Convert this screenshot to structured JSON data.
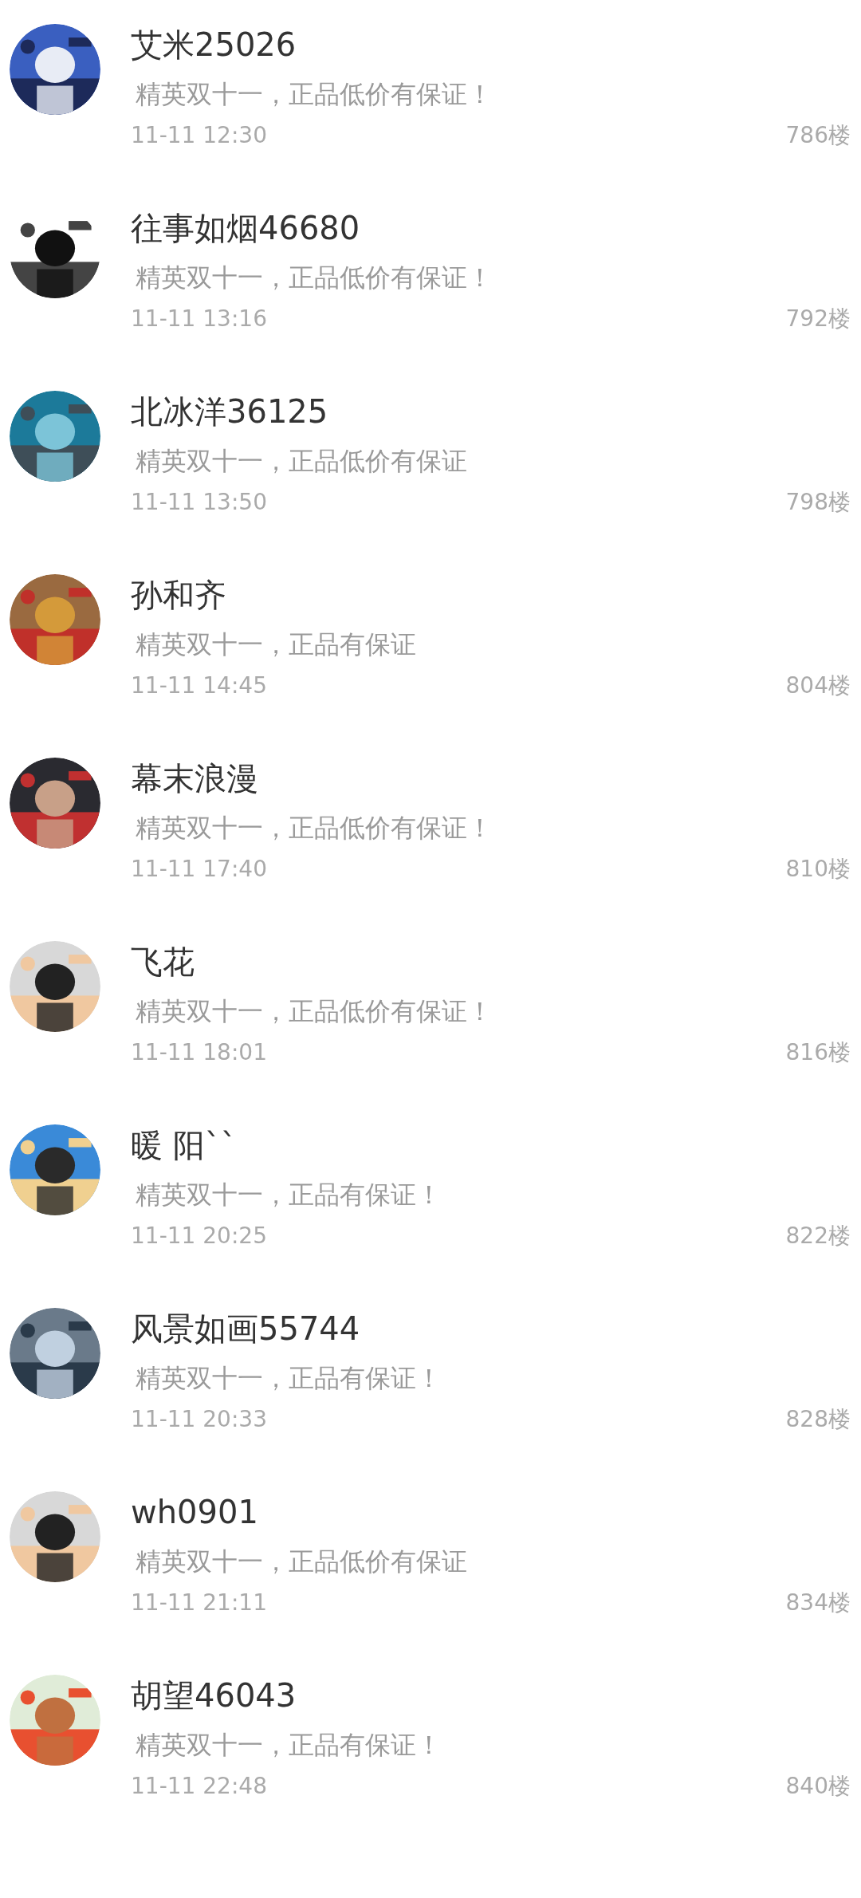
{
  "comments": [
    {
      "name": "艾米25026",
      "text": "精英双十一，正品低价有保证！",
      "time": "11-11 12:30",
      "floor": "786楼"
    },
    {
      "name": "往事如烟46680",
      "text": "精英双十一，正品低价有保证！",
      "time": "11-11 13:16",
      "floor": "792楼"
    },
    {
      "name": "北冰洋36125",
      "text": "精英双十一，正品低价有保证",
      "time": "11-11 13:50",
      "floor": "798楼"
    },
    {
      "name": "孙和齐",
      "text": "精英双十一，正品有保证",
      "time": "11-11 14:45",
      "floor": "804楼"
    },
    {
      "name": "幕末浪漫",
      "text": "精英双十一，正品低价有保证！",
      "time": "11-11 17:40",
      "floor": "810楼"
    },
    {
      "name": "飞花",
      "text": "精英双十一，正品低价有保证！",
      "time": "11-11 18:01",
      "floor": "816楼"
    },
    {
      "name": "暖 阳``",
      "text": "精英双十一，正品有保证！",
      "time": "11-11 20:25",
      "floor": "822楼"
    },
    {
      "name": "风景如画55744",
      "text": "精英双十一，正品有保证！",
      "time": "11-11 20:33",
      "floor": "828楼"
    },
    {
      "name": "wh0901",
      "text": "精英双十一，正品低价有保证",
      "time": "11-11 21:11",
      "floor": "834楼"
    },
    {
      "name": "胡望46043",
      "text": "精英双十一，正品有保证！",
      "time": "11-11 22:48",
      "floor": "840楼"
    }
  ]
}
